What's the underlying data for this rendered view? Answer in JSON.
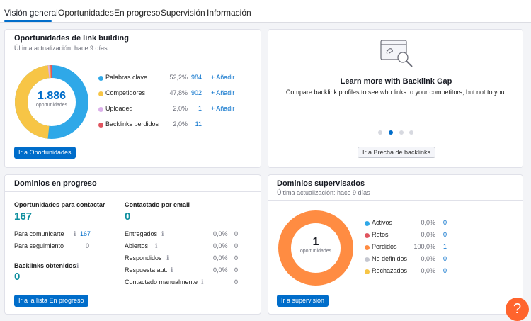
{
  "tabs": [
    {
      "label": "Visión general",
      "active": true
    },
    {
      "label": "Oportunidades"
    },
    {
      "label": "En progreso"
    },
    {
      "label": "Supervisión"
    },
    {
      "label": "Información"
    }
  ],
  "opportunities": {
    "title": "Oportunidades de link building",
    "subtitle": "Última actualización: hace 9 días",
    "total": "1.886",
    "total_label": "oportunidades",
    "legend": [
      {
        "label": "Palabras clave",
        "pct": "52,2%",
        "value": "984",
        "add": "+ Añadir",
        "color": "#2fa8e8"
      },
      {
        "label": "Competidores",
        "pct": "47,8%",
        "value": "902",
        "add": "+ Añadir",
        "color": "#f7c546"
      },
      {
        "label": "Uploaded",
        "pct": "2,0%",
        "value": "1",
        "add": "+ Añadir",
        "color": "#dbb0ea"
      },
      {
        "label": "Backlinks perdidos",
        "pct": "2,0%",
        "value": "11",
        "add": "",
        "color": "#e0555f"
      }
    ],
    "button": "Ir a Oportunidades"
  },
  "promo": {
    "icon": "backlink-search-icon",
    "title": "Learn more with Backlink Gap",
    "text": "Compare backlink profiles to see who links to your competitors, but not to you.",
    "active_slide": 1,
    "slide_count": 4,
    "button": "Ir a Brecha de backlinks"
  },
  "in_progress": {
    "title": "Dominios en progreso",
    "to_contact_label": "Oportunidades para contactar",
    "to_contact_value": "167",
    "rows_left": [
      {
        "label": "Para comunicarte",
        "value": "167"
      },
      {
        "label": "Para seguimiento",
        "value": "0"
      }
    ],
    "obtained_label": "Backlinks obtenidos",
    "obtained_value": "0",
    "email_label": "Contactado por email",
    "email_value": "0",
    "rows_right": [
      {
        "label": "Entregados",
        "pct": "0,0%",
        "value": "0"
      },
      {
        "label": "Abiertos",
        "pct": "0,0%",
        "value": "0"
      },
      {
        "label": "Respondidos",
        "pct": "0,0%",
        "value": "0"
      },
      {
        "label": "Respuesta aut.",
        "pct": "0,0%",
        "value": "0"
      },
      {
        "label": "Contactado manualmente",
        "pct": "",
        "value": "0"
      }
    ],
    "button": "Ir a la lista En progreso"
  },
  "monitored": {
    "title": "Dominios supervisados",
    "subtitle": "Última actualización: hace 9 días",
    "total": "1",
    "total_label": "oportunidades",
    "legend": [
      {
        "label": "Activos",
        "pct": "0,0%",
        "value": "0",
        "color": "#2fa8e8"
      },
      {
        "label": "Rotos",
        "pct": "0,0%",
        "value": "0",
        "color": "#e0555f"
      },
      {
        "label": "Perdidos",
        "pct": "100,0%",
        "value": "1",
        "color": "#ff8c42"
      },
      {
        "label": "No definidos",
        "pct": "0,0%",
        "value": "0",
        "color": "#c5c7d0"
      },
      {
        "label": "Rechazados",
        "pct": "0,0%",
        "value": "0",
        "color": "#f7c546"
      }
    ],
    "button": "Ir a supervisión"
  },
  "help": {
    "label": "?"
  }
}
